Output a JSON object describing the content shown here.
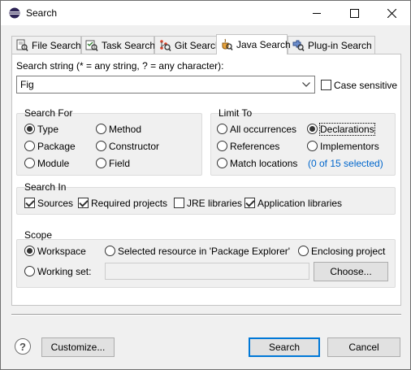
{
  "window": {
    "title": "Search",
    "minimize_icon": "minimize-icon",
    "maximize_icon": "maximize-icon",
    "close_icon": "close-icon"
  },
  "tabs": [
    {
      "label": "File Search",
      "icon": "file-search-icon",
      "active": false
    },
    {
      "label": "Task Search",
      "icon": "task-search-icon",
      "active": false
    },
    {
      "label": "Git Search",
      "icon": "git-search-icon",
      "active": false
    },
    {
      "label": "Java Search",
      "icon": "java-search-icon",
      "active": true
    },
    {
      "label": "Plug-in Search",
      "icon": "plugin-search-icon",
      "active": false
    }
  ],
  "search_string": {
    "label": "Search string (* = any string, ? = any character):",
    "value": "Fig",
    "case_sensitive_label": "Case sensitive",
    "case_sensitive": false
  },
  "search_for": {
    "title": "Search For",
    "options": [
      {
        "label": "Type",
        "selected": true
      },
      {
        "label": "Method",
        "selected": false
      },
      {
        "label": "Package",
        "selected": false
      },
      {
        "label": "Constructor",
        "selected": false
      },
      {
        "label": "Module",
        "selected": false
      },
      {
        "label": "Field",
        "selected": false
      }
    ]
  },
  "limit_to": {
    "title": "Limit To",
    "options": [
      {
        "label": "All occurrences",
        "selected": false
      },
      {
        "label": "Declarations",
        "selected": true
      },
      {
        "label": "References",
        "selected": false
      },
      {
        "label": "Implementors",
        "selected": false
      },
      {
        "label": "Match locations",
        "selected": false
      }
    ],
    "match_link": "(0 of 15 selected)"
  },
  "search_in": {
    "title": "Search In",
    "options": [
      {
        "label": "Sources",
        "checked": true
      },
      {
        "label": "Required projects",
        "checked": true
      },
      {
        "label": "JRE libraries",
        "checked": false
      },
      {
        "label": "Application libraries",
        "checked": true
      }
    ]
  },
  "scope": {
    "title": "Scope",
    "options": [
      {
        "label": "Workspace",
        "selected": true
      },
      {
        "label": "Selected resource in 'Package Explorer'",
        "selected": false
      },
      {
        "label": "Enclosing project",
        "selected": false
      },
      {
        "label": "Working set:",
        "selected": false
      }
    ],
    "working_set_value": "",
    "choose_label": "Choose..."
  },
  "footer": {
    "help_symbol": "?",
    "customize_label": "Customize...",
    "search_label": "Search",
    "cancel_label": "Cancel"
  },
  "colors": {
    "link": "#0066cc",
    "default_button_border": "#0078d7"
  }
}
